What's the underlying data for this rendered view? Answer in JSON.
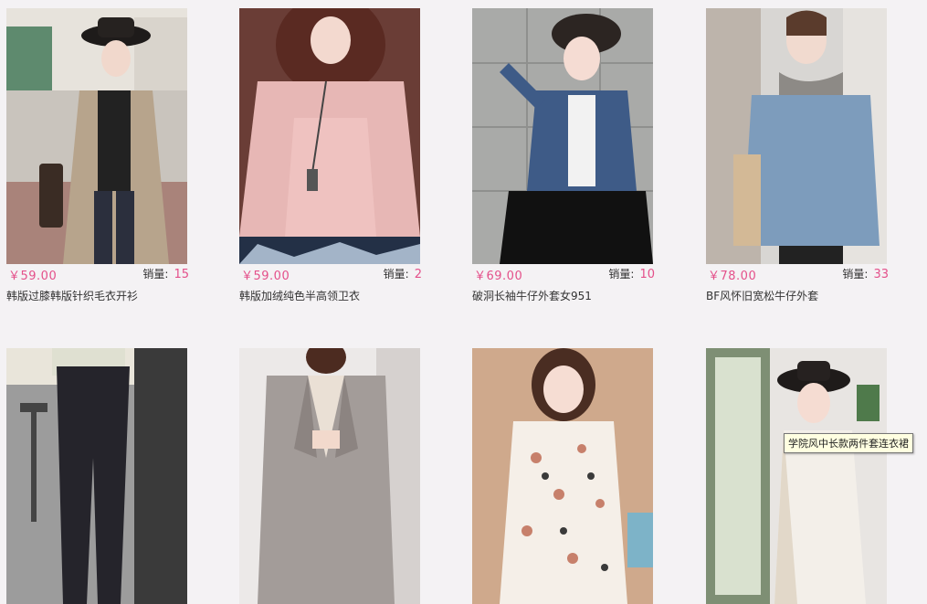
{
  "products": [
    {
      "price": "￥59.00",
      "sales_label": "销量:",
      "sales": "15",
      "name": "韩版过膝韩版针织毛衣开衫",
      "image": "beige-long-cardigan-hat"
    },
    {
      "price": "￥59.00",
      "sales_label": "销量:",
      "sales": "2",
      "name": "韩版加绒纯色半高领卫衣",
      "image": "pink-sweatshirt"
    },
    {
      "price": "￥69.00",
      "sales_label": "销量:",
      "sales": "10",
      "name": "破洞长袖牛仔外套女951",
      "image": "denim-jacket-black-skirt"
    },
    {
      "price": "￥78.00",
      "sales_label": "销量:",
      "sales": "33",
      "name": "BF风怀旧宽松牛仔外套",
      "image": "oversized-denim-jacket"
    },
    {
      "price": "",
      "sales_label": "",
      "sales": "",
      "name": "",
      "image": "black-leggings"
    },
    {
      "price": "",
      "sales_label": "",
      "sales": "",
      "name": "",
      "image": "grey-wool-coat"
    },
    {
      "price": "",
      "sales_label": "",
      "sales": "",
      "name": "",
      "image": "floral-shirt-dress"
    },
    {
      "price": "",
      "sales_label": "",
      "sales": "",
      "name": "",
      "image": "two-piece-dress-hat"
    }
  ],
  "tooltip": "学院风中长款两件套连衣裙",
  "colors": {
    "accent": "#e4508a",
    "background": "#f4f2f4",
    "text": "#333333"
  }
}
